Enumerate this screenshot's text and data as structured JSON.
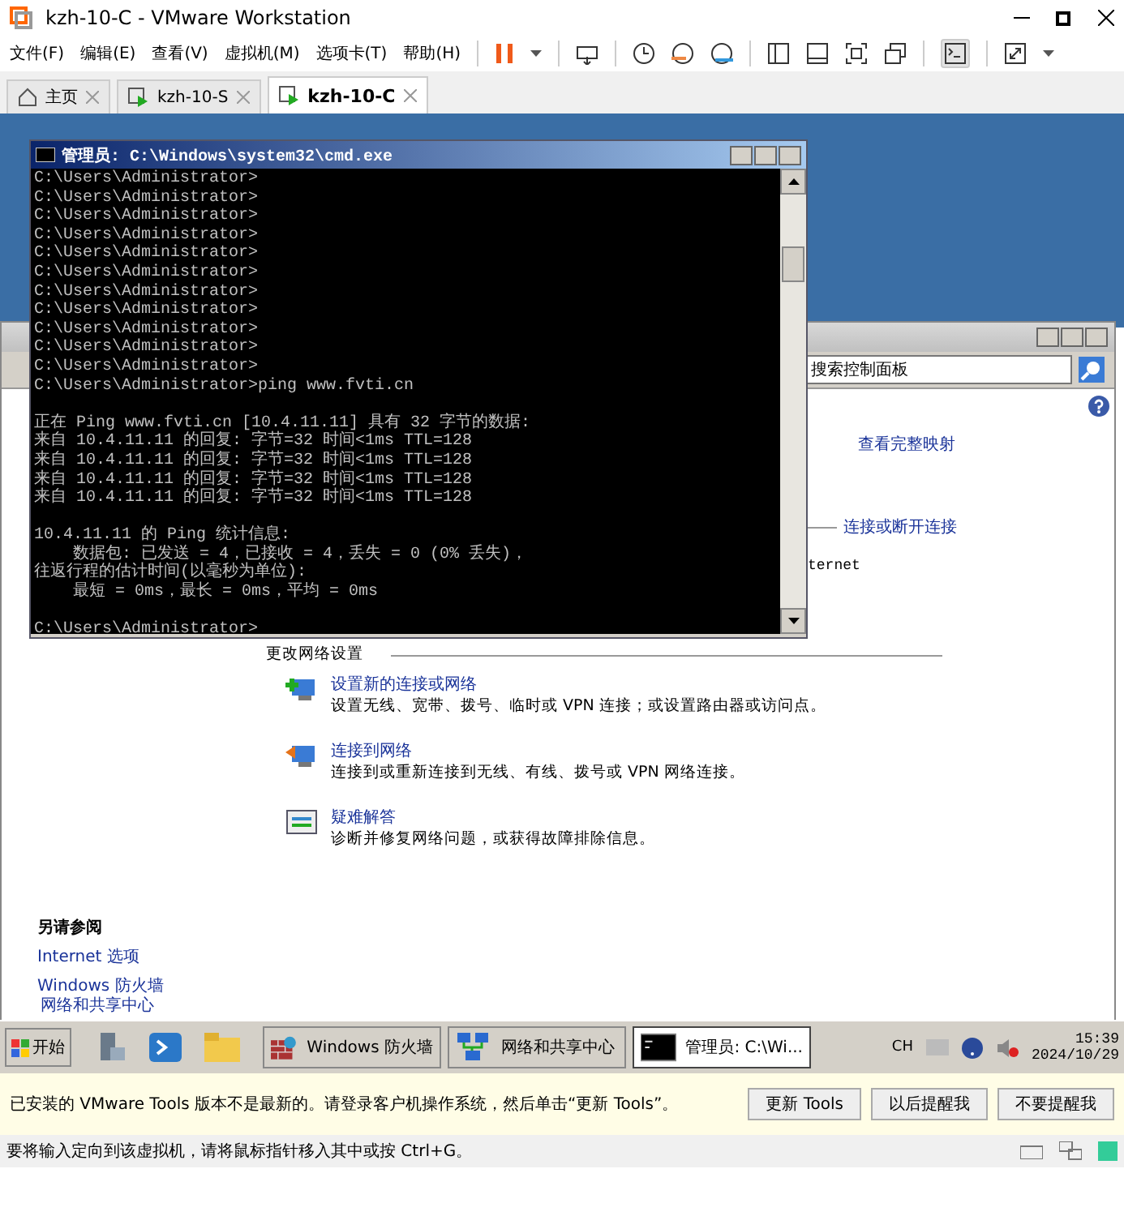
{
  "window": {
    "title": "kzh-10-C - VMware Workstation"
  },
  "menu": [
    "文件(F)",
    "编辑(E)",
    "查看(V)",
    "虚拟机(M)",
    "选项卡(T)",
    "帮助(H)"
  ],
  "tabs": [
    {
      "label": "主页",
      "kind": "home",
      "selected": false
    },
    {
      "label": "kzh-10-S",
      "kind": "vm",
      "selected": false
    },
    {
      "label": "kzh-10-C",
      "kind": "vm",
      "selected": true
    }
  ],
  "guest": {
    "cmd": {
      "title": "管理员: C:\\Windows\\system32\\cmd.exe",
      "blocks": [
        [
          "C:\\Users\\Administrator>",
          "C:\\Users\\Administrator>",
          "C:\\Users\\Administrator>",
          "C:\\Users\\Administrator>",
          "C:\\Users\\Administrator>",
          "C:\\Users\\Administrator>",
          "C:\\Users\\Administrator>",
          "C:\\Users\\Administrator>",
          "C:\\Users\\Administrator>",
          "C:\\Users\\Administrator>",
          "C:\\Users\\Administrator>",
          "C:\\Users\\Administrator>ping www.fvti.cn"
        ],
        [
          "正在 Ping www.fvti.cn [10.4.11.11] 具有 32 字节的数据:",
          "来自 10.4.11.11 的回复: 字节=32 时间<1ms TTL=128",
          "来自 10.4.11.11 的回复: 字节=32 时间<1ms TTL=128",
          "来自 10.4.11.11 的回复: 字节=32 时间<1ms TTL=128",
          "来自 10.4.11.11 的回复: 字节=32 时间<1ms TTL=128"
        ],
        [
          "10.4.11.11 的 Ping 统计信息:",
          "    数据包: 已发送 = 4，已接收 = 4，丢失 = 0 (0% 丢失)，",
          "往返行程的估计时间(以毫秒为单位):",
          "    最短 = 0ms，最长 = 0ms，平均 = 0ms"
        ],
        [
          "C:\\Users\\Administrator>"
        ]
      ]
    },
    "control_panel": {
      "search": {
        "placeholder": "搜索控制面板"
      },
      "map_link": "查看完整映射",
      "connect_link": "连接或断开连接",
      "partial_text": "ternet",
      "section_heading": "更改网络设置",
      "tasks": [
        {
          "kind": "new",
          "title": "设置新的连接或网络",
          "description": "设置无线、宽带、拨号、临时或 VPN 连接；或设置路由器或访问点。"
        },
        {
          "kind": "connect",
          "title": "连接到网络",
          "description": "连接到或重新连接到无线、有线、拨号或 VPN 网络连接。"
        },
        {
          "kind": "troubleshoot",
          "title": "疑难解答",
          "description": "诊断并修复网络问题，或获得故障排除信息。"
        }
      ],
      "see_also": {
        "heading": "另请参阅",
        "links": [
          "Internet 选项",
          "Windows 防火墙"
        ]
      }
    },
    "background_link": "网络和共享中心",
    "taskbar": {
      "start": "开始",
      "buttons": [
        {
          "label": "Windows 防火墙",
          "kind": "firewall",
          "selected": false
        },
        {
          "label": "网络和共享中心",
          "kind": "network",
          "selected": false
        },
        {
          "label": "管理员: C:\\Wi...",
          "kind": "cmd",
          "selected": true
        }
      ],
      "language": "CH",
      "time": "15:39",
      "date": "2024/10/29"
    }
  },
  "notification": {
    "message": "已安装的 VMware Tools 版本不是最新的。请登录客户机操作系统，然后单击“更新 Tools”。",
    "buttons": [
      "更新 Tools",
      "以后提醒我",
      "不要提醒我"
    ]
  },
  "status_bar": {
    "text": "要将输入定向到该虚拟机，请将鼠标指针移入其中或按 Ctrl+G。"
  }
}
